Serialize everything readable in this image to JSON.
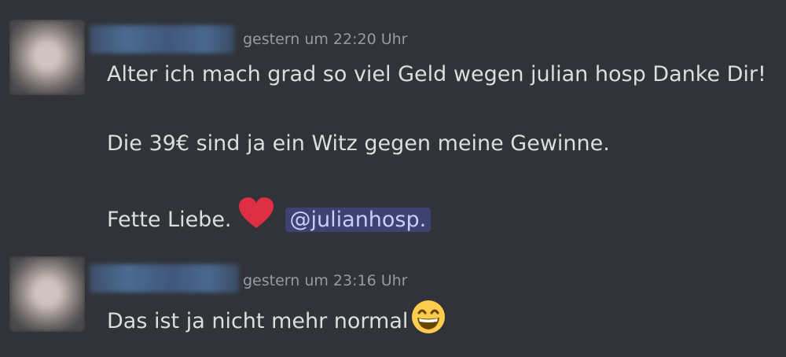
{
  "messages": [
    {
      "timestamp": "gestern um 22:20 Uhr",
      "lines": [
        "Alter ich mach grad so viel Geld wegen julian hosp Danke Dir!",
        "Die 39€ sind ja ein Witz gegen meine Gewinne.",
        "Fette Liebe."
      ],
      "emoji": "heart-icon",
      "mention": "@julianhosp."
    },
    {
      "timestamp": "gestern um 23:16 Uhr",
      "lines": [
        "Das ist ja nicht mehr normal"
      ],
      "emoji": "grinning-smile-icon"
    }
  ],
  "colors": {
    "background": "#313338",
    "text": "#dbdee1",
    "timestamp": "#949ba4",
    "mention_bg": "#3d4270",
    "mention_text": "#c9cdfb"
  }
}
